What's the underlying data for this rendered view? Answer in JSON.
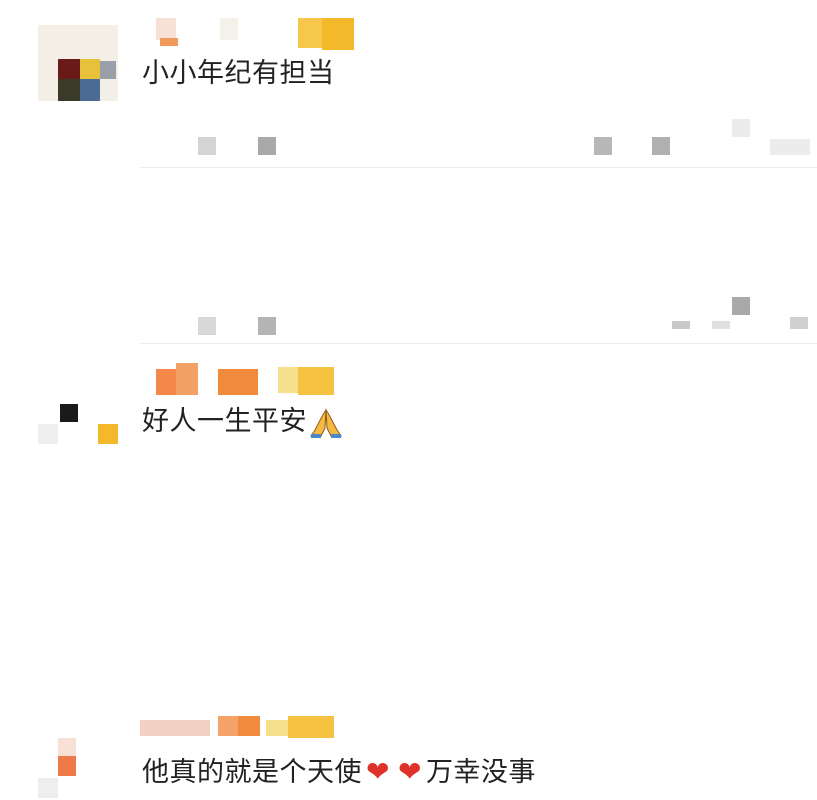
{
  "comments": [
    {
      "text": "小小年纪有担当"
    },
    {
      "text": "好人一生平安"
    },
    {
      "text_before": "他真的就是个天使",
      "text_after": "万幸没事"
    }
  ],
  "icons": {
    "heart": "heart-icon",
    "pray": "folded-hands-icon"
  },
  "colors": {
    "text": "#222222",
    "heart": "#e0302a",
    "pixel_orange": "#f08a3c",
    "pixel_yellow": "#f5c242",
    "pixel_gray": "#bdbdbd"
  }
}
